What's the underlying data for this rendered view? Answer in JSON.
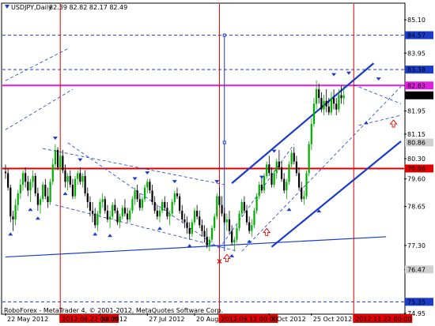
{
  "chart_data": {
    "type": "candlestick",
    "header": {
      "icon": "down-triangle",
      "symbol_tf": "USDJPY,Daily",
      "ohlc": "82.39 82.82 82.17 82.49"
    },
    "footer": "RoboForex - MetaTrader 4, © 2001-2012, MetaQuotes Software Corp.",
    "ylim": [
      74.95,
      85.65
    ],
    "xlim": [
      0,
      159
    ],
    "grid": false,
    "y_ticks": [
      "85.10",
      "83.95",
      "82.83",
      "81.95",
      "81.15",
      "80.30",
      "79.60",
      "78.65",
      "77.30",
      "76.47",
      "74.95"
    ],
    "price_labels": [
      {
        "text": "84.57",
        "value": 84.57,
        "color": "#1a3cc9"
      },
      {
        "text": "83.38",
        "value": 83.38,
        "color": "#1a3cc9"
      },
      {
        "text": "82.83",
        "value": 82.83,
        "color": "#e020e0"
      },
      {
        "text": "82.49",
        "value": 82.49,
        "color": "#000000"
      },
      {
        "text": "80.86",
        "value": 80.86,
        "color": "#d0d0d0"
      },
      {
        "text": "79.96",
        "value": 79.96,
        "color": "#e00000"
      },
      {
        "text": "76.47",
        "value": 76.47,
        "color": "#d0d0d0"
      },
      {
        "text": "75.35",
        "value": 75.35,
        "color": "#1a3cc9"
      }
    ],
    "x_ticks": [
      {
        "text": "22 May 2012",
        "bar": 0
      },
      {
        "text": "2012.06.22 00:00",
        "bar": 22,
        "highlight": true
      },
      {
        "text": "Jul 2012",
        "bar": 38
      },
      {
        "text": "27 Jul 2012",
        "bar": 57
      },
      {
        "text": "20 Aug 2012",
        "bar": 76
      },
      {
        "text": "2012.09.12 00:00",
        "bar": 86,
        "highlight": true
      },
      {
        "text": "3 Oct 2012",
        "bar": 106
      },
      {
        "text": "25 Oct 2012",
        "bar": 123
      },
      {
        "text": "2012.11.22 00:00",
        "bar": 140,
        "highlight": true
      }
    ],
    "h_lines": [
      {
        "value": 84.57,
        "color": "#1a3cc9",
        "style": "dash"
      },
      {
        "value": 83.38,
        "color": "#1a3cc9",
        "style": "dash"
      },
      {
        "value": 82.83,
        "color": "#e020e0",
        "style": "solid",
        "width": 2
      },
      {
        "value": 79.96,
        "color": "#e00000",
        "style": "solid",
        "width": 2
      },
      {
        "value": 75.35,
        "color": "#1a3cc9",
        "style": "dash"
      }
    ],
    "v_lines": [
      {
        "bar": 22,
        "color": "#e00000"
      },
      {
        "bar": 86,
        "color": "#e00000"
      },
      {
        "bar": 140,
        "color": "#e00000"
      }
    ],
    "segment": {
      "bar": 88,
      "from": 84.57,
      "to": 77.1,
      "color": "#1a3cc9"
    },
    "channel_lines": [
      {
        "from": [
          0,
          76.9
        ],
        "to": [
          153,
          77.6
        ],
        "width": 1.2
      },
      {
        "from": [
          107,
          77.25
        ],
        "to": [
          159,
          80.9
        ],
        "width": 2.2
      },
      {
        "from": [
          91,
          79.45
        ],
        "to": [
          148,
          83.6
        ],
        "width": 2.2
      }
    ],
    "dashed_lines": [
      {
        "from": [
          0,
          83.0
        ],
        "to": [
          25,
          84.1
        ]
      },
      {
        "from": [
          0,
          81.3
        ],
        "to": [
          27,
          82.7
        ]
      },
      {
        "from": [
          15,
          80.65
        ],
        "to": [
          88,
          79.4
        ]
      },
      {
        "from": [
          25,
          80.85
        ],
        "to": [
          86,
          77.2
        ]
      },
      {
        "from": [
          20,
          78.7
        ],
        "to": [
          93,
          77.1
        ]
      },
      {
        "from": [
          86,
          77.2
        ],
        "to": [
          116,
          80.8
        ]
      },
      {
        "from": [
          95,
          77.1
        ],
        "to": [
          159,
          82.8
        ]
      },
      {
        "from": [
          140,
          82.85
        ],
        "to": [
          159,
          82.2
        ]
      },
      {
        "from": [
          142,
          81.45
        ],
        "to": [
          159,
          81.8
        ]
      }
    ],
    "ohlc": [
      [
        79.85,
        80.1,
        79.6,
        79.8
      ],
      [
        79.8,
        79.95,
        79.2,
        79.3
      ],
      [
        79.3,
        79.4,
        78.1,
        78.3
      ],
      [
        78.3,
        78.5,
        77.8,
        78.2
      ],
      [
        78.2,
        78.9,
        78.0,
        78.7
      ],
      [
        78.7,
        79.2,
        78.5,
        79.1
      ],
      [
        79.1,
        79.6,
        78.9,
        79.4
      ],
      [
        79.4,
        79.9,
        79.2,
        79.8
      ],
      [
        79.8,
        80.0,
        79.3,
        79.5
      ],
      [
        79.5,
        79.7,
        79.0,
        79.2
      ],
      [
        79.2,
        79.6,
        78.8,
        79.5
      ],
      [
        79.5,
        79.9,
        79.3,
        79.7
      ],
      [
        79.7,
        79.8,
        79.0,
        79.1
      ],
      [
        79.1,
        79.3,
        78.5,
        78.7
      ],
      [
        78.7,
        79.0,
        78.4,
        78.9
      ],
      [
        78.9,
        79.5,
        78.8,
        79.4
      ],
      [
        79.4,
        79.6,
        78.9,
        79.0
      ],
      [
        79.0,
        79.3,
        78.6,
        78.8
      ],
      [
        78.8,
        79.6,
        78.7,
        79.5
      ],
      [
        79.5,
        80.3,
        79.4,
        80.1
      ],
      [
        80.1,
        80.8,
        79.9,
        80.6
      ],
      [
        80.6,
        80.7,
        79.9,
        80.0
      ],
      [
        80.0,
        80.5,
        79.8,
        80.4
      ],
      [
        80.4,
        80.6,
        79.8,
        79.9
      ],
      [
        79.9,
        80.1,
        79.3,
        79.5
      ],
      [
        79.5,
        79.8,
        79.2,
        79.7
      ],
      [
        79.7,
        79.9,
        79.3,
        79.4
      ],
      [
        79.4,
        79.6,
        78.9,
        79.0
      ],
      [
        79.0,
        79.7,
        78.9,
        79.6
      ],
      [
        79.6,
        79.9,
        79.4,
        79.8
      ],
      [
        79.8,
        80.0,
        79.4,
        79.5
      ],
      [
        79.5,
        79.8,
        79.3,
        79.7
      ],
      [
        79.7,
        79.9,
        79.0,
        79.1
      ],
      [
        79.1,
        79.3,
        78.6,
        78.8
      ],
      [
        78.8,
        79.0,
        78.3,
        78.5
      ],
      [
        78.5,
        78.8,
        78.1,
        78.4
      ],
      [
        78.4,
        78.6,
        77.9,
        78.0
      ],
      [
        78.0,
        78.5,
        77.8,
        78.4
      ],
      [
        78.4,
        78.9,
        78.3,
        78.8
      ],
      [
        78.8,
        79.1,
        78.6,
        78.9
      ],
      [
        78.9,
        79.0,
        78.4,
        78.5
      ],
      [
        78.5,
        78.7,
        78.1,
        78.2
      ],
      [
        78.2,
        78.5,
        77.9,
        78.3
      ],
      [
        78.3,
        78.8,
        78.2,
        78.7
      ],
      [
        78.7,
        78.9,
        78.4,
        78.5
      ],
      [
        78.5,
        78.6,
        78.0,
        78.1
      ],
      [
        78.1,
        78.4,
        77.9,
        78.3
      ],
      [
        78.3,
        78.7,
        78.2,
        78.6
      ],
      [
        78.6,
        78.9,
        78.3,
        78.4
      ],
      [
        78.4,
        78.6,
        78.1,
        78.2
      ],
      [
        78.2,
        78.6,
        78.1,
        78.5
      ],
      [
        78.5,
        79.0,
        78.4,
        78.9
      ],
      [
        78.9,
        79.3,
        78.7,
        79.2
      ],
      [
        79.2,
        79.4,
        78.8,
        78.9
      ],
      [
        78.9,
        79.1,
        78.5,
        78.6
      ],
      [
        78.6,
        79.0,
        78.5,
        78.9
      ],
      [
        78.9,
        79.4,
        78.8,
        79.3
      ],
      [
        79.3,
        79.6,
        79.1,
        79.5
      ],
      [
        79.5,
        79.6,
        79.1,
        79.2
      ],
      [
        79.2,
        79.4,
        78.7,
        78.8
      ],
      [
        78.8,
        79.0,
        78.4,
        78.5
      ],
      [
        78.5,
        78.7,
        78.2,
        78.3
      ],
      [
        78.3,
        78.6,
        78.1,
        78.5
      ],
      [
        78.5,
        78.9,
        78.4,
        78.8
      ],
      [
        78.8,
        79.0,
        78.5,
        78.6
      ],
      [
        78.6,
        78.8,
        78.2,
        78.3
      ],
      [
        78.3,
        78.5,
        78.0,
        78.4
      ],
      [
        78.4,
        78.9,
        78.3,
        78.8
      ],
      [
        78.8,
        79.2,
        78.7,
        79.1
      ],
      [
        79.1,
        79.3,
        78.9,
        79.0
      ],
      [
        79.0,
        79.1,
        78.4,
        78.5
      ],
      [
        78.5,
        78.7,
        78.1,
        78.2
      ],
      [
        78.2,
        78.4,
        77.9,
        78.1
      ],
      [
        78.1,
        78.3,
        77.7,
        77.9
      ],
      [
        77.9,
        78.1,
        77.5,
        77.7
      ],
      [
        77.7,
        78.2,
        77.6,
        78.1
      ],
      [
        78.1,
        78.6,
        78.0,
        78.5
      ],
      [
        78.5,
        78.7,
        78.2,
        78.3
      ],
      [
        78.3,
        78.5,
        77.9,
        78.0
      ],
      [
        78.0,
        78.2,
        77.6,
        77.8
      ],
      [
        77.8,
        78.0,
        77.4,
        77.6
      ],
      [
        77.6,
        77.9,
        77.2,
        77.3
      ],
      [
        77.3,
        77.6,
        77.1,
        77.5
      ],
      [
        77.5,
        78.0,
        77.4,
        77.9
      ],
      [
        77.9,
        78.4,
        77.8,
        78.3
      ],
      [
        78.3,
        79.1,
        78.2,
        79.0
      ],
      [
        79.0,
        79.3,
        78.6,
        78.7
      ],
      [
        78.7,
        79.0,
        78.3,
        78.4
      ],
      [
        78.4,
        78.6,
        78.0,
        78.1
      ],
      [
        78.1,
        78.4,
        77.8,
        78.2
      ],
      [
        78.2,
        78.5,
        77.7,
        77.8
      ],
      [
        77.8,
        78.0,
        77.3,
        77.4
      ],
      [
        77.4,
        77.6,
        77.1,
        77.5
      ],
      [
        77.5,
        78.0,
        77.4,
        77.9
      ],
      [
        77.9,
        78.5,
        77.8,
        78.4
      ],
      [
        78.4,
        78.9,
        78.3,
        78.8
      ],
      [
        78.8,
        79.0,
        78.4,
        78.5
      ],
      [
        78.5,
        78.7,
        78.0,
        78.1
      ],
      [
        78.1,
        78.3,
        77.7,
        77.8
      ],
      [
        77.8,
        78.2,
        77.6,
        78.0
      ],
      [
        78.0,
        78.6,
        77.9,
        78.5
      ],
      [
        78.5,
        79.1,
        78.4,
        79.0
      ],
      [
        79.0,
        79.5,
        78.9,
        79.4
      ],
      [
        79.4,
        79.7,
        79.1,
        79.2
      ],
      [
        79.2,
        79.8,
        79.1,
        79.7
      ],
      [
        79.7,
        80.2,
        79.6,
        80.1
      ],
      [
        80.1,
        80.4,
        79.7,
        79.8
      ],
      [
        79.8,
        80.0,
        79.3,
        79.4
      ],
      [
        79.4,
        79.9,
        79.3,
        79.8
      ],
      [
        79.8,
        80.3,
        79.6,
        80.2
      ],
      [
        80.2,
        80.6,
        79.9,
        80.0
      ],
      [
        80.0,
        80.2,
        79.5,
        79.6
      ],
      [
        79.6,
        79.8,
        79.1,
        79.2
      ],
      [
        79.2,
        79.6,
        78.9,
        79.5
      ],
      [
        79.5,
        80.2,
        79.4,
        80.1
      ],
      [
        80.1,
        80.6,
        80.0,
        80.5
      ],
      [
        80.5,
        80.7,
        80.1,
        80.2
      ],
      [
        80.2,
        80.4,
        79.7,
        79.8
      ],
      [
        79.8,
        80.0,
        79.2,
        79.3
      ],
      [
        79.3,
        79.5,
        78.8,
        78.9
      ],
      [
        78.9,
        79.2,
        78.7,
        79.0
      ],
      [
        79.0,
        79.9,
        78.9,
        79.8
      ],
      [
        79.8,
        80.9,
        79.7,
        80.8
      ],
      [
        80.8,
        81.7,
        80.6,
        81.5
      ],
      [
        81.5,
        82.4,
        81.4,
        82.2
      ],
      [
        82.2,
        83.0,
        82.0,
        82.7
      ],
      [
        82.7,
        82.9,
        82.2,
        82.4
      ],
      [
        82.4,
        82.6,
        81.9,
        82.0
      ],
      [
        82.0,
        82.5,
        81.8,
        82.3
      ],
      [
        82.3,
        82.7,
        81.9,
        82.1
      ],
      [
        82.1,
        82.4,
        81.8,
        81.9
      ],
      [
        81.9,
        82.6,
        81.8,
        82.4
      ],
      [
        82.4,
        82.7,
        82.0,
        82.2
      ],
      [
        82.2,
        82.4,
        81.8,
        82.0
      ],
      [
        82.0,
        82.7,
        81.9,
        82.5
      ],
      [
        82.5,
        82.82,
        82.2,
        82.39
      ],
      [
        82.39,
        82.82,
        82.17,
        82.49
      ]
    ],
    "fractal_arrows": [
      {
        "bar": 2,
        "value": 77.75,
        "dir": "up"
      },
      {
        "bar": 10,
        "value": 78.6,
        "dir": "up"
      },
      {
        "bar": 13,
        "value": 78.3,
        "dir": "up"
      },
      {
        "bar": 20,
        "value": 80.95,
        "dir": "down"
      },
      {
        "bar": 24,
        "value": 79.15,
        "dir": "up"
      },
      {
        "bar": 30,
        "value": 80.2,
        "dir": "down"
      },
      {
        "bar": 36,
        "value": 77.75,
        "dir": "up"
      },
      {
        "bar": 42,
        "value": 77.7,
        "dir": "up"
      },
      {
        "bar": 52,
        "value": 79.55,
        "dir": "down"
      },
      {
        "bar": 57,
        "value": 79.75,
        "dir": "down"
      },
      {
        "bar": 62,
        "value": 77.95,
        "dir": "up"
      },
      {
        "bar": 68,
        "value": 79.45,
        "dir": "down"
      },
      {
        "bar": 74,
        "value": 77.35,
        "dir": "up"
      },
      {
        "bar": 85,
        "value": 79.45,
        "dir": "down"
      },
      {
        "bar": 91,
        "value": 77.0,
        "dir": "up"
      },
      {
        "bar": 98,
        "value": 77.5,
        "dir": "up"
      },
      {
        "bar": 103,
        "value": 79.6,
        "dir": "down"
      },
      {
        "bar": 108,
        "value": 80.5,
        "dir": "down"
      },
      {
        "bar": 114,
        "value": 78.6,
        "dir": "up"
      },
      {
        "bar": 126,
        "value": 78.55,
        "dir": "up"
      },
      {
        "bar": 132,
        "value": 83.15,
        "dir": "down"
      },
      {
        "bar": 138,
        "value": 83.2,
        "dir": "down"
      },
      {
        "bar": 145,
        "value": 81.6,
        "dir": "up"
      },
      {
        "bar": 150,
        "value": 83.0,
        "dir": "down"
      }
    ],
    "hollow_arrows": [
      {
        "bar": 89,
        "value": 76.85,
        "color": "#e00000"
      },
      {
        "bar": 105,
        "value": 77.75,
        "color": "#e00000"
      },
      {
        "bar": 156,
        "value": 81.5,
        "color": "#e00000"
      }
    ],
    "x_mark": {
      "bar": 86,
      "value": 76.75,
      "color": "#e00000"
    }
  }
}
